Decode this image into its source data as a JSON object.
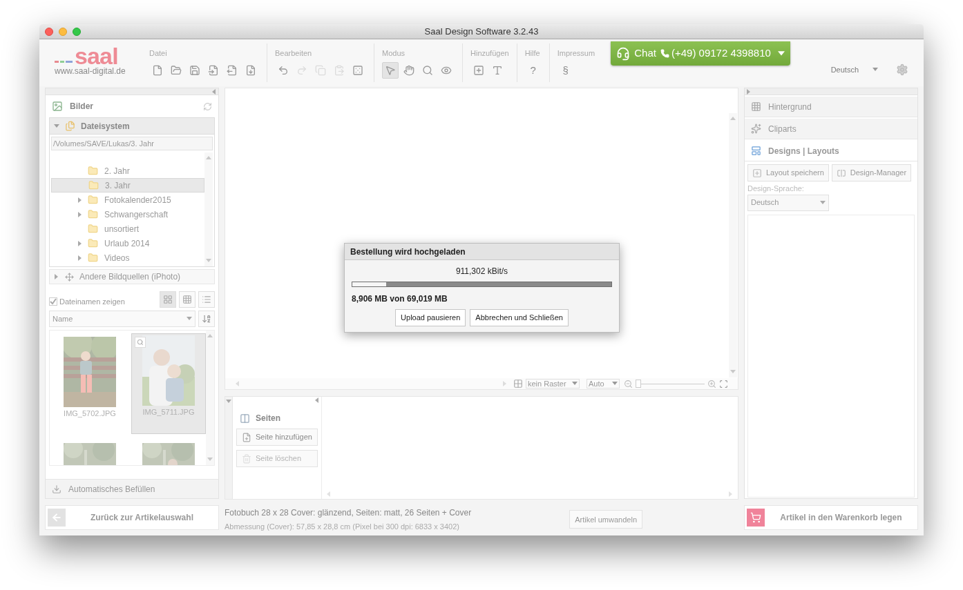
{
  "window": {
    "title": "Saal Design Software 3.2.43"
  },
  "logo": {
    "wordmark": "saal",
    "url": "www.saal-digital.de"
  },
  "toolbar": {
    "groups": [
      {
        "label": "Datei",
        "tools": [
          {
            "disabled": false
          },
          {
            "disabled": false
          },
          {
            "disabled": false
          },
          {
            "disabled": false
          },
          {
            "disabled": false
          },
          {
            "disabled": false
          }
        ]
      },
      {
        "label": "Bearbeiten",
        "tools": [
          {
            "disabled": false
          },
          {
            "disabled": true
          },
          {
            "disabled": true
          },
          {
            "disabled": true
          },
          {
            "disabled": false
          }
        ]
      },
      {
        "label": "Modus",
        "tools": [
          {
            "selected": true
          },
          {
            "selected": false
          },
          {
            "selected": false
          },
          {
            "selected": false
          }
        ]
      },
      {
        "label": "Hinzufügen",
        "tools": [
          {
            "disabled": false
          },
          {
            "disabled": false
          }
        ]
      },
      {
        "label": "Hilfe",
        "tools": [
          {
            "text": "?"
          }
        ]
      },
      {
        "label": "Impressum",
        "tools": [
          {
            "text": "§"
          }
        ]
      }
    ]
  },
  "chat": {
    "label": "Chat",
    "phone": "(+49) 09172 4398810"
  },
  "language": "Deutsch",
  "images_panel": {
    "title": "Bilder",
    "filesystem": {
      "title": "Dateisystem",
      "expanded": true,
      "path": "/Volumes/SAVE/Lukas/3. Jahr",
      "folders": [
        {
          "name": "2. Jahr",
          "has_children": false,
          "selected": false
        },
        {
          "name": "3. Jahr",
          "has_children": false,
          "selected": true
        },
        {
          "name": "Fotokalender2015",
          "has_children": true,
          "selected": false
        },
        {
          "name": "Schwangerschaft",
          "has_children": true,
          "selected": false
        },
        {
          "name": "unsortiert",
          "has_children": false,
          "selected": false
        },
        {
          "name": "Urlaub 2014",
          "has_children": true,
          "selected": false
        },
        {
          "name": "Videos",
          "has_children": true,
          "selected": false
        }
      ]
    },
    "other_sources": {
      "title": "Andere Bildquellen (iPhoto)",
      "expanded": false
    },
    "show_filenames": {
      "label": "Dateinamen zeigen",
      "checked": true
    },
    "view_modes": [
      {
        "selected": true
      },
      {
        "selected": false
      },
      {
        "selected": false
      }
    ],
    "sort": {
      "value": "Name"
    },
    "thumbnails": [
      {
        "filename": "IMG_5702.JPG",
        "selected": false
      },
      {
        "filename": "IMG_5711.JPG",
        "selected": true
      },
      {
        "selected": false
      },
      {
        "selected": false
      }
    ],
    "auto_fill": "Automatisches Befüllen"
  },
  "back_button": "Zurück zur Artikelauswahl",
  "canvas": {
    "grid": "kein Raster",
    "zoom": "Auto",
    "zoom_slider": {
      "level": 0
    }
  },
  "upload_dialog": {
    "title": "Bestellung wird hochgeladen",
    "speed": "911,302 kBit/s",
    "progress": {
      "level": 0.13
    },
    "amount": "8,906 MB von 69,019 MB",
    "buttons": [
      "Upload pausieren",
      "Abbrechen und Schließen"
    ]
  },
  "pages_panel": {
    "title": "Seiten",
    "buttons": [
      {
        "label": "Seite hinzufügen",
        "disabled": false
      },
      {
        "label": "Seite löschen",
        "disabled": true
      }
    ]
  },
  "right_panel": {
    "sections": [
      {
        "title": "Hintergrund",
        "expanded": false
      },
      {
        "title": "Cliparts",
        "expanded": false
      },
      {
        "title": "Designs | Layouts",
        "expanded": true
      }
    ],
    "buttons": [
      "Layout speichern",
      "Design-Manager"
    ],
    "language_label": "Design-Sprache:",
    "language": "Deutsch"
  },
  "status": {
    "product": "Fotobuch 28 x 28 Cover: glänzend, Seiten: matt, 26 Seiten + Cover",
    "dimensions": "Abmessung (Cover): 57,85 x 28,8 cm (Pixel bei 300 dpi: 6833 x 3402)",
    "convert_button": "Artikel umwandeln",
    "cart_button": "Artikel in den Warenkorb legen"
  }
}
